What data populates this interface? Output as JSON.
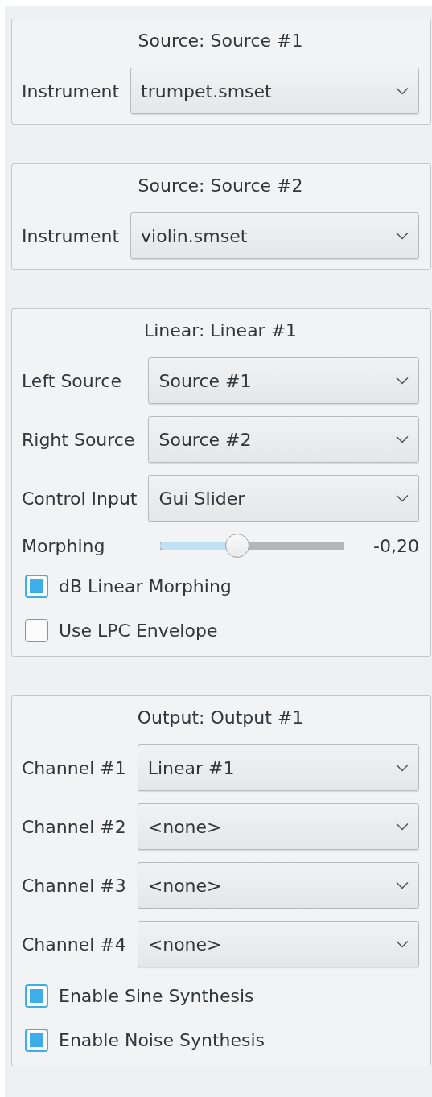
{
  "groups": [
    {
      "title": "Source: Source #1",
      "rows": [
        {
          "kind": "combo",
          "label": "Instrument",
          "value": "trumpet.smset"
        }
      ]
    },
    {
      "title": "Source: Source #2",
      "rows": [
        {
          "kind": "combo",
          "label": "Instrument",
          "value": "violin.smset"
        }
      ]
    },
    {
      "title": "Linear: Linear #1",
      "rows": [
        {
          "kind": "combo",
          "label": "Left Source",
          "value": "Source #1"
        },
        {
          "kind": "combo",
          "label": "Right Source",
          "value": "Source #2"
        },
        {
          "kind": "combo",
          "label": "Control Input",
          "value": "Gui Slider"
        },
        {
          "kind": "slider",
          "label": "Morphing",
          "level": 0.42,
          "reading": "-0,20"
        },
        {
          "kind": "checkbox",
          "label": "dB Linear Morphing",
          "checked": true
        },
        {
          "kind": "checkbox",
          "label": "Use LPC Envelope",
          "checked": false
        }
      ]
    },
    {
      "title": "Output: Output #1",
      "rows": [
        {
          "kind": "combo",
          "label": "Channel #1",
          "value": "Linear #1"
        },
        {
          "kind": "combo",
          "label": "Channel #2",
          "value": "<none>"
        },
        {
          "kind": "combo",
          "label": "Channel #3",
          "value": "<none>"
        },
        {
          "kind": "combo",
          "label": "Channel #4",
          "value": "<none>"
        },
        {
          "kind": "checkbox",
          "label": "Enable Sine Synthesis",
          "checked": true
        },
        {
          "kind": "checkbox",
          "label": "Enable Noise Synthesis",
          "checked": true
        }
      ]
    }
  ]
}
